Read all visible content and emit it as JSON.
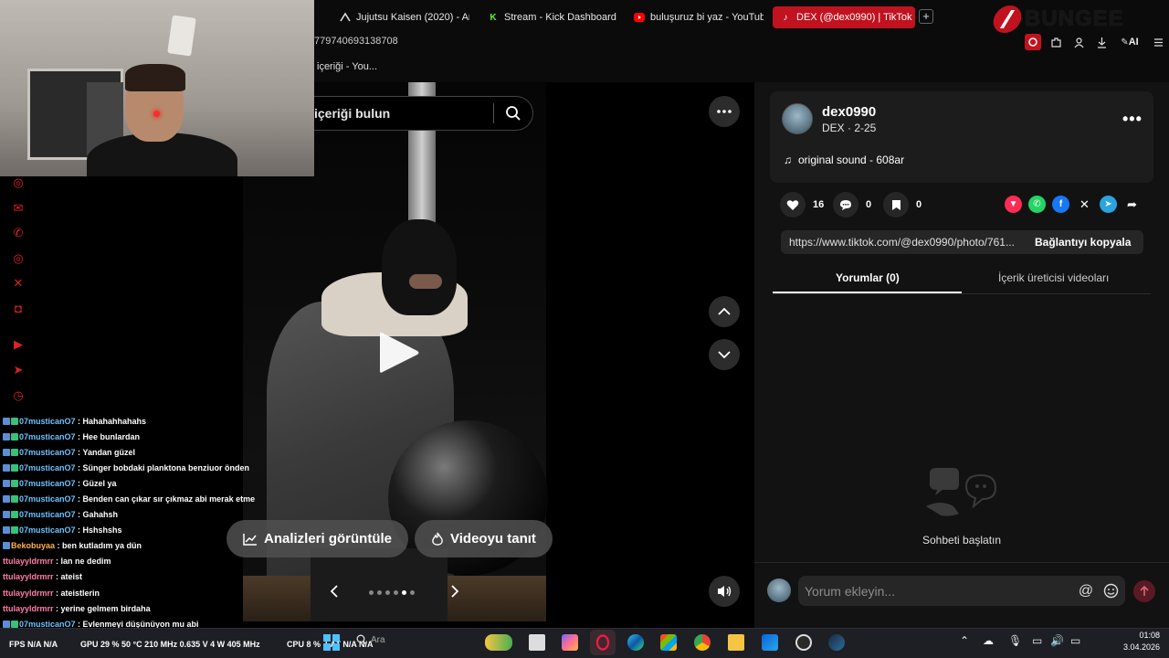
{
  "browser": {
    "tabs": [
      {
        "label": "Jujutsu Kaisen (2020) - Ar",
        "icon": "crunchyroll-icon"
      },
      {
        "label": "Stream - Kick Dashboard",
        "icon": "kick-icon"
      },
      {
        "label": "buluşuruz bi yaz - YouTub",
        "icon": "youtube-icon"
      },
      {
        "label": "DEX (@dex0990) | TikTok",
        "icon": "tiktok-icon",
        "active": true
      }
    ],
    "url_fragment": "779740693138708",
    "bookmark": "içeriği - You...",
    "ai_label": "AI",
    "brand": "BUNGEE"
  },
  "social_icons": [
    "instagram-icon",
    "messenger-icon",
    "whatsapp-icon",
    "instagram-alt-icon",
    "x-icon",
    "discord-icon",
    "youtube-icon",
    "send-icon",
    "clock-icon"
  ],
  "chat": [
    {
      "user": "07musticanO7",
      "text": "Hahahahhahahs",
      "color": "blue"
    },
    {
      "user": "07musticanO7",
      "text": "Hee bunlardan",
      "color": "blue"
    },
    {
      "user": "07musticanO7",
      "text": "Yandan güzel",
      "color": "blue"
    },
    {
      "user": "07musticanO7",
      "text": "Sünger bobdaki planktona benziuor önden",
      "color": "blue"
    },
    {
      "user": "07musticanO7",
      "text": "Güzel ya",
      "color": "blue"
    },
    {
      "user": "07musticanO7",
      "text": "Benden can çıkar sır çıkmaz abi merak etme",
      "color": "blue"
    },
    {
      "user": "07musticanO7",
      "text": "Gahahsh",
      "color": "blue"
    },
    {
      "user": "07musticanO7",
      "text": "Hshshshs",
      "color": "blue"
    },
    {
      "user": "Bekobuyaa",
      "text": "ben kutladım ya dün",
      "color": "orange"
    },
    {
      "user": "ttulayyldrmrr",
      "text": "lan ne dedim",
      "color": "pink"
    },
    {
      "user": "ttulayyldrmrr",
      "text": "ateist",
      "color": "pink"
    },
    {
      "user": "ttulayyldrmrr",
      "text": "ateistlerin",
      "color": "pink"
    },
    {
      "user": "ttulayyldrmrr",
      "text": "yerine gelmem birdaha",
      "color": "pink"
    },
    {
      "user": "07musticanO7",
      "text": "Evlenmeyi düşünüyon mu abi",
      "color": "blue"
    }
  ],
  "video": {
    "search_placeholder": "içeriği bulun",
    "analytics_label": "Analizleri görüntüle",
    "promote_label": "Videoyu tanıt",
    "dot_count": 6,
    "active_dot": 4
  },
  "profile": {
    "username": "dex0990",
    "subline": "DEX · 2-25",
    "sound": "original sound - 608ar",
    "likes": "16",
    "comments": "0",
    "saves": "0",
    "link": "https://www.tiktok.com/@dex0990/photo/761...",
    "copy_label": "Bağlantıyı kopyala",
    "tabs": [
      "Yorumlar (0)",
      "İçerik üreticisi videoları"
    ],
    "empty_text": "Sohbeti başlatın",
    "comment_placeholder": "Yorum ekleyin..."
  },
  "taskbar": {
    "gpu": "GPU  29 %  50 °C  210 MHz  0.635 V  4 W  405 MHz",
    "cpu": "CPU  8 %",
    "lat": "LAT  N/A  N/A",
    "fps": "FPS  N/A  N/A",
    "search": "Ara",
    "time": "01:08",
    "date": "3.04.2026"
  },
  "colors": {
    "accent": "#c1121f",
    "panel_bg": "#121212",
    "chat_blue": "#6ec3ff",
    "chat_pink": "#ff7fa8"
  }
}
